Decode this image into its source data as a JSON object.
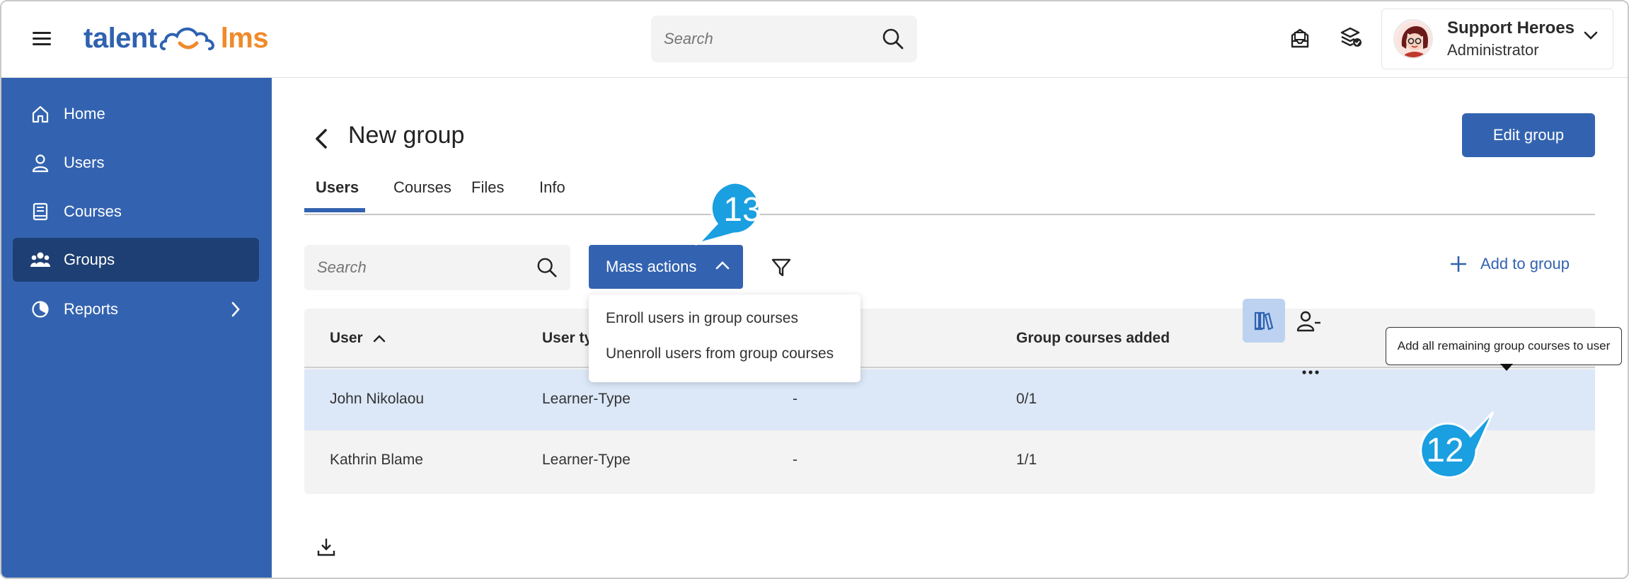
{
  "app": {
    "logo_left": "talent",
    "logo_right": "lms"
  },
  "topbar": {
    "search_placeholder": "Search",
    "icons": [
      "inbox-icon",
      "layers-badge-icon"
    ],
    "user": {
      "name": "Support Heroes",
      "role": "Administrator"
    }
  },
  "sidebar": {
    "items": [
      {
        "label": "Home",
        "icon": "home-icon",
        "active": false
      },
      {
        "label": "Users",
        "icon": "user-icon",
        "active": false
      },
      {
        "label": "Courses",
        "icon": "book-icon",
        "active": false
      },
      {
        "label": "Groups",
        "icon": "groups-icon",
        "active": true
      },
      {
        "label": "Reports",
        "icon": "pie-chart-icon",
        "active": false
      }
    ]
  },
  "page": {
    "title": "New group",
    "edit_button": "Edit group",
    "tabs": [
      "Users",
      "Courses",
      "Files",
      "Info"
    ],
    "active_tab": "Users",
    "search_placeholder": "Search",
    "mass_actions": "Mass actions",
    "add_to_group": "Add to group",
    "mass_menu": [
      "Enroll users in group courses",
      "Unenroll users from group courses"
    ]
  },
  "table": {
    "columns": [
      "User",
      "User ty",
      "",
      "Group courses added"
    ],
    "rows": [
      {
        "user": "John Nikolaou",
        "type": "Learner-Type",
        "col3": "-",
        "added": "0/1"
      },
      {
        "user": "Kathrin Blame",
        "type": "Learner-Type",
        "col3": "-",
        "added": "1/1"
      }
    ]
  },
  "tooltip": "Add all remaining group courses to user",
  "callouts": [
    "13",
    "12"
  ],
  "colors": {
    "brand_blue": "#3363b0",
    "sidebar_active": "#1e3f73",
    "logo_orange": "#f08a2a",
    "callout_blue": "#1a9fe0",
    "row_highlight": "#dce8f8"
  }
}
